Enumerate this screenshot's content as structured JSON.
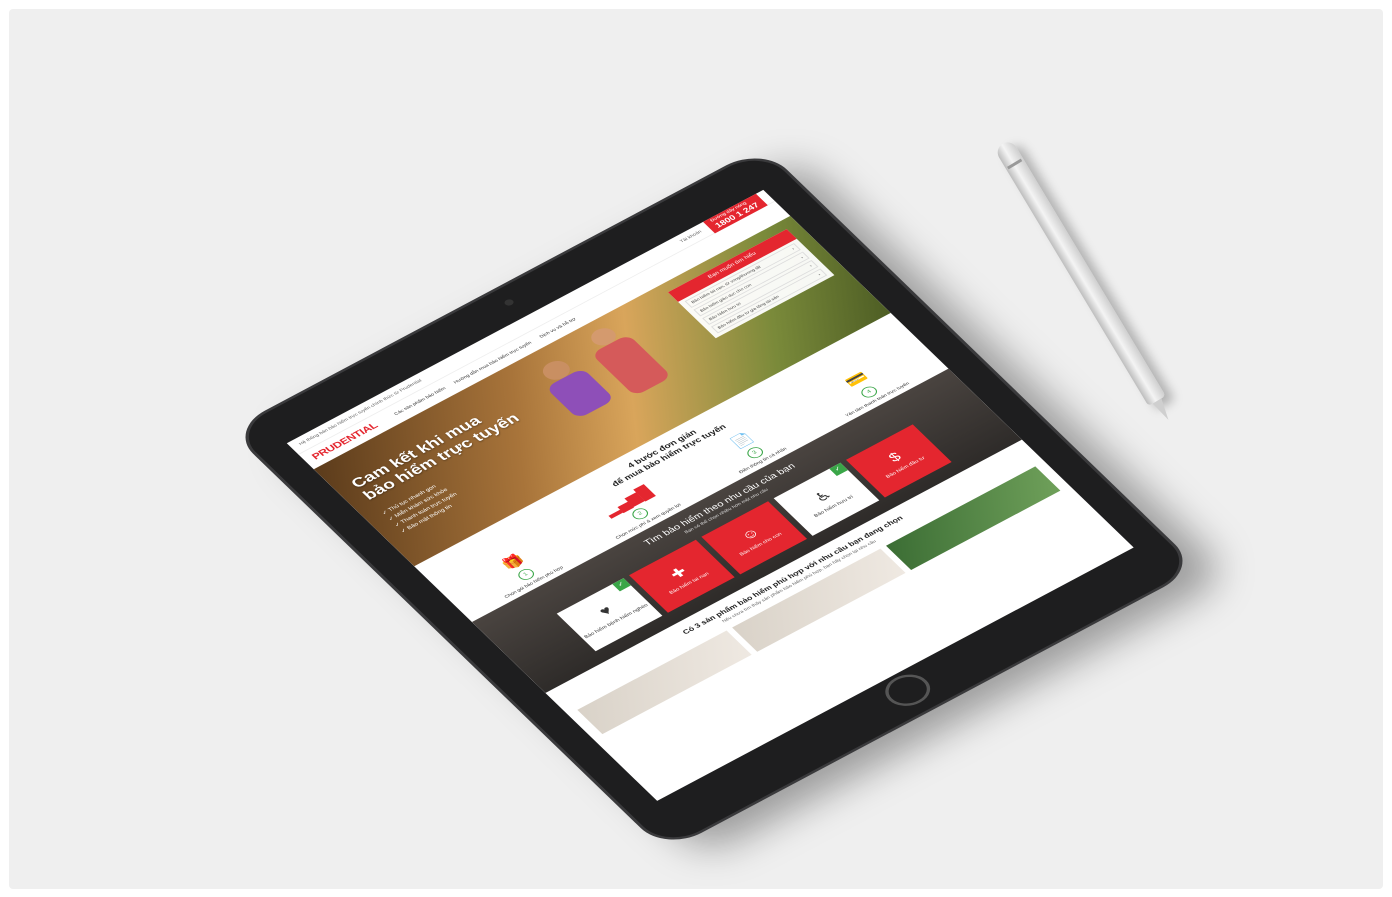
{
  "site": {
    "topbar_left": "Hệ thống bán bảo hiểm trực tuyến chính thức từ Prudential",
    "account": "Tài khoản",
    "hotline_label": "Đường dây nóng",
    "hotline_number": "1800 1 247",
    "logo_text": "PRUDENTIAL",
    "nav": [
      "Các sản phẩm bảo hiểm",
      "Hướng dẫn mua bảo hiểm trực tuyến",
      "Dịch vụ và hỗ trợ"
    ]
  },
  "hero": {
    "title_line1": "Cam kết khi mua",
    "title_line2": "bảo hiểm trực tuyến",
    "bullets": [
      "Thủ tục nhanh gọn",
      "Miễn khám sức khỏe",
      "Thanh toán trực tuyến",
      "Bảo mật thông tin"
    ],
    "form_title": "Bạn muốn tìm hiểu",
    "form_rows": [
      "Bảo hiểm tai nạn, tử vong/thương tật",
      "Bảo hiểm giáo dục cho con",
      "Bảo hiểm hưu trí",
      "Bảo hiểm đầu tư gia tăng tài sản"
    ]
  },
  "steps": {
    "title_line1": "4 bước đơn giản",
    "title_line2": "để mua bảo hiểm trực tuyến",
    "items": [
      {
        "num": "1",
        "label": "Chọn gói bảo hiểm phù hợp",
        "icon": "hand-gift-icon"
      },
      {
        "num": "2",
        "label": "Chọn mức phí & xem quyền lợi",
        "icon": "chart-bars-icon"
      },
      {
        "num": "3",
        "label": "Điền thông tin cá nhân",
        "icon": "document-user-icon"
      },
      {
        "num": "4",
        "label": "Yên tâm thanh toán trực tuyến",
        "icon": "credit-card-icon"
      }
    ]
  },
  "needs": {
    "title": "Tìm bảo hiểm theo nhu cầu của bạn",
    "subtitle": "Bạn có thể chọn nhiều hơn một nhu cầu",
    "tiles": [
      {
        "label": "Bảo hiểm bệnh hiểm nghèo",
        "style": "white",
        "checked": true
      },
      {
        "label": "Bảo hiểm tai nạn",
        "style": "red",
        "checked": false
      },
      {
        "label": "Bảo hiểm cho con",
        "style": "red",
        "checked": false
      },
      {
        "label": "Bảo hiểm hưu trí",
        "style": "white",
        "checked": true
      },
      {
        "label": "Bảo hiểm đầu tư",
        "style": "red",
        "checked": false
      }
    ]
  },
  "results": {
    "title": "Có 3 sản phẩm bảo hiểm phù hợp với nhu cầu bạn đang chọn",
    "subtitle": "Nếu chưa tìm thấy sản phẩm bảo hiểm phù hợp, bạn hãy chọn lại nhu cầu"
  },
  "colors": {
    "brand": "#e4262f",
    "check": "#3aa648"
  }
}
